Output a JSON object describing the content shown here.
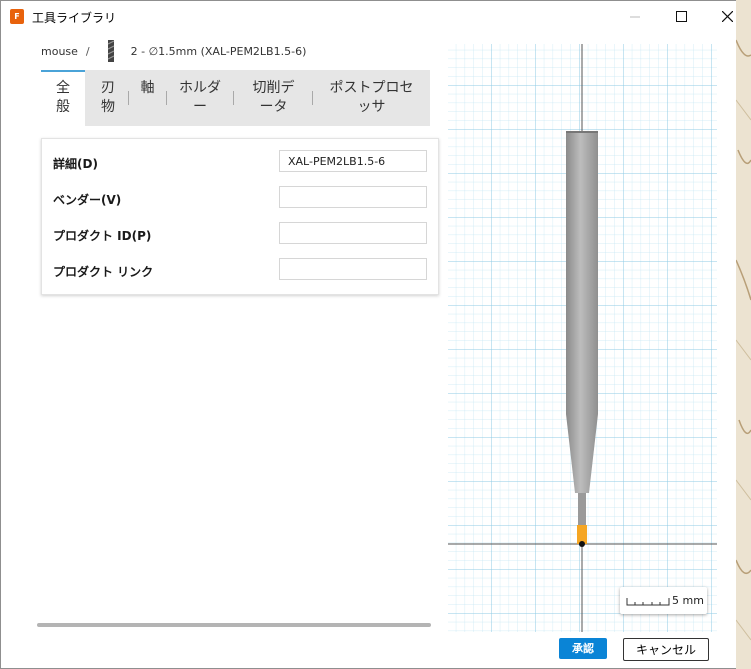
{
  "window": {
    "title": "工具ライブラリ",
    "app_icon_letter": "F"
  },
  "breadcrumb": {
    "library": "mouse",
    "separator": "/",
    "tool": "2 - ∅1.5mm (XAL-PEM2LB1.5-6)"
  },
  "tabs": [
    {
      "line1": "全",
      "line2": "般",
      "active": true
    },
    {
      "line1": "刃",
      "line2": "物",
      "active": false
    },
    {
      "line1": "軸",
      "line2": "",
      "active": false
    },
    {
      "line1": "ホルダ",
      "line2": "ー",
      "active": false
    },
    {
      "line1": "切削デ",
      "line2": "ータ",
      "active": false
    },
    {
      "line1": "ポストプロセ",
      "line2": "ッサ",
      "active": false
    }
  ],
  "form": {
    "description": {
      "label": "詳細(D)",
      "value": "XAL-PEM2LB1.5-6"
    },
    "vendor": {
      "label": "ベンダー(V)",
      "value": ""
    },
    "product_id": {
      "label": "プロダクト ID(P)",
      "value": ""
    },
    "product_link": {
      "label": "プロダクト リンク",
      "value": ""
    }
  },
  "viewer": {
    "scale_label": "5 mm"
  },
  "buttons": {
    "ok": "承認",
    "cancel": "キャンセル"
  },
  "colors": {
    "accent": "#0a84d6",
    "tab_active_border": "#4aa3d8",
    "grid": "#a8d8ee",
    "tool_tip": "#f5a623"
  }
}
